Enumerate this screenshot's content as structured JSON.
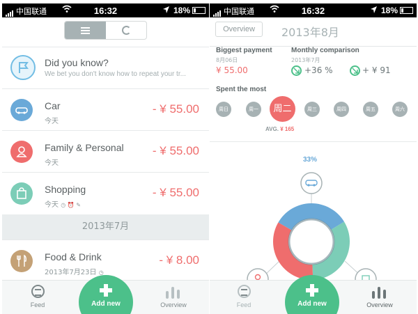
{
  "left": {
    "status": {
      "carrier": "中国联通",
      "time": "16:32",
      "battery": "18%"
    },
    "segmented": {
      "left_icon": "list-icon",
      "right_icon": "refresh-icon"
    },
    "tip": {
      "title": "Did you know?",
      "subtitle": "We bet you don't know how to repeat your tr...",
      "icon": "flag-icon"
    },
    "items": [
      {
        "title": "Car",
        "sub": "今天",
        "amount": "- ¥ 55.00",
        "color": "#6aa9d8",
        "icon": "car-icon"
      },
      {
        "title": "Family & Personal",
        "sub": "今天",
        "amount": "- ¥ 55.00",
        "color": "#ef6d6d",
        "icon": "person-icon"
      },
      {
        "title": "Shopping",
        "sub": "今天",
        "amount": "- ¥ 55.00",
        "color": "#7ccdb7",
        "icon": "bag-icon"
      }
    ],
    "month_header": "2013年7月",
    "item4": {
      "title": "Food & Drink",
      "sub": "2013年7月23日",
      "amount": "- ¥ 8.00",
      "color": "#c4a176",
      "icon": "utensils-icon"
    },
    "tabbar": {
      "feed": "Feed",
      "add": "Add new",
      "overview": "Overview"
    }
  },
  "right": {
    "status": {
      "carrier": "中国联通",
      "time": "16:32",
      "battery": "18%"
    },
    "nav": {
      "back": "Overview",
      "title": "2013年8月"
    },
    "biggest": {
      "label": "Biggest payment",
      "date": "8月06日",
      "value": "¥ 55.00"
    },
    "comparison": {
      "label": "Monthly comparison",
      "date": "2013年7月",
      "pct": "+36 %",
      "amount": "+ ¥ 91"
    },
    "spent": {
      "label": "Spent the most",
      "days": [
        "周日",
        "周一",
        "周二",
        "周三",
        "周四",
        "周五",
        "周六"
      ],
      "active_index": 2,
      "avg_label": "AVG.",
      "avg_value": "¥ 165"
    },
    "donut": {
      "top_pct": "33%"
    },
    "chart_data": {
      "type": "pie",
      "segments": [
        {
          "category": "Car",
          "color": "#6aa9d8",
          "pct": 33
        },
        {
          "category": "Shopping",
          "color": "#7ccdb7",
          "pct": 33
        },
        {
          "category": "Family & Personal",
          "color": "#ef6d6d",
          "pct": 34
        }
      ]
    },
    "tabbar": {
      "feed": "Feed",
      "add": "Add new",
      "overview": "Overview"
    }
  }
}
